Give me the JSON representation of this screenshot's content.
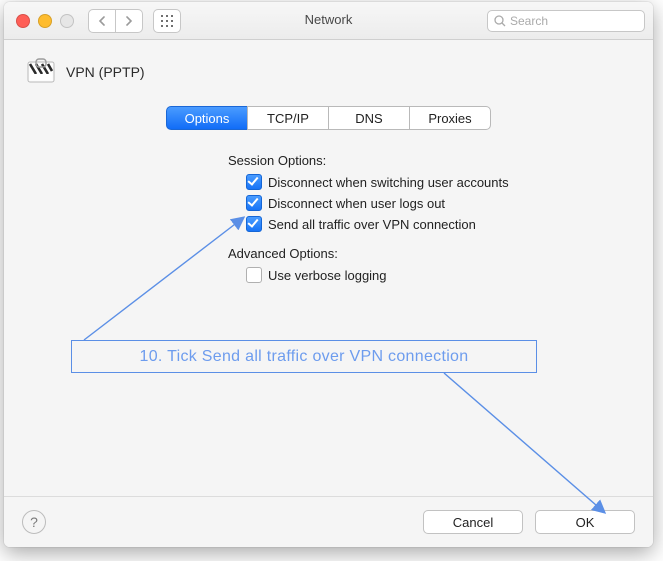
{
  "window": {
    "title": "Network",
    "search_placeholder": "Search"
  },
  "header": {
    "service_label": "VPN (PPTP)"
  },
  "tabs": [
    {
      "id": "options",
      "label": "Options",
      "selected": true
    },
    {
      "id": "tcpip",
      "label": "TCP/IP",
      "selected": false
    },
    {
      "id": "dns",
      "label": "DNS",
      "selected": false
    },
    {
      "id": "proxies",
      "label": "Proxies",
      "selected": false
    }
  ],
  "session": {
    "heading": "Session Options:",
    "items": [
      {
        "id": "disconnect_switch",
        "label": "Disconnect when switching user accounts",
        "checked": true
      },
      {
        "id": "disconnect_logout",
        "label": "Disconnect when user logs out",
        "checked": true
      },
      {
        "id": "send_all",
        "label": "Send all traffic over VPN connection",
        "checked": true
      }
    ]
  },
  "advanced": {
    "heading": "Advanced Options:",
    "items": [
      {
        "id": "verbose",
        "label": "Use verbose logging",
        "checked": false
      }
    ]
  },
  "buttons": {
    "cancel": "Cancel",
    "ok": "OK",
    "help": "?"
  },
  "annotation": {
    "text": "10. Tick Send all traffic over VPN connection"
  },
  "colors": {
    "accent_blue": "#1874f6",
    "annotation_stroke": "#5b8fe6"
  }
}
